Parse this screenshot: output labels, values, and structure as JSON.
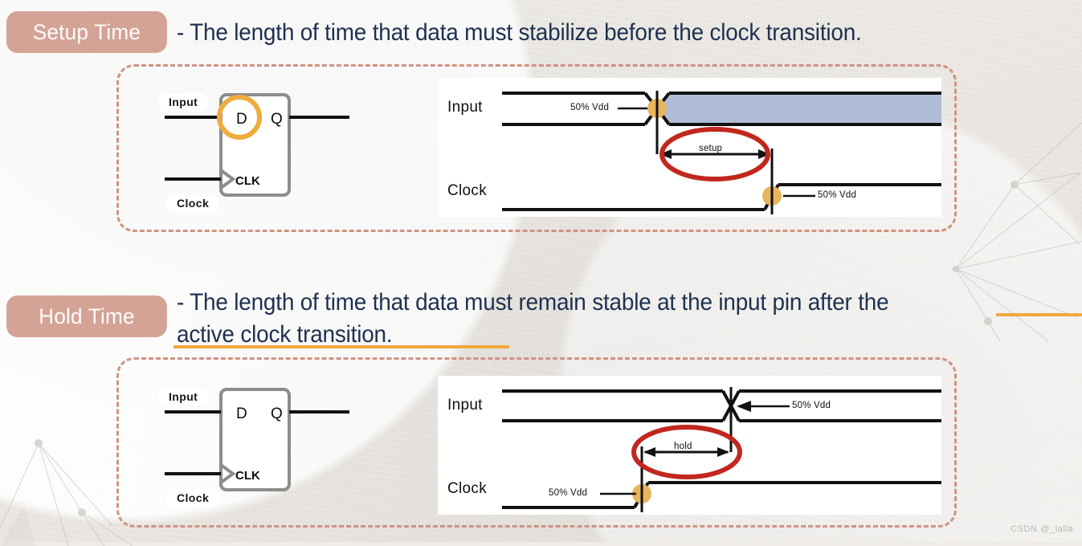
{
  "slide": {
    "background_color": "#efece7",
    "text_color": "#1d3050",
    "badge_color": "#d4a396",
    "dash_color": "#cf9383",
    "highlight_color": "#f0a83c",
    "band_color": "#b0bdd8",
    "ellipse_color": "#c0281e",
    "node_color": "#e8b45c"
  },
  "sections": [
    {
      "badge_label": "Setup Time",
      "description": "- The length of time that data must stabilize before the clock transition.",
      "flipflop": {
        "input_label": "Input",
        "clock_label": "Clock",
        "d_pin": "D",
        "q_pin": "Q",
        "clk_pin": "CLK",
        "highlighted_pin": "D"
      },
      "timing": {
        "input_row_label": "Input",
        "clock_row_label": "Clock",
        "input_threshold_label": "50% Vdd",
        "clock_threshold_label": "50% Vdd",
        "measure_label": "setup",
        "has_data_band": true
      }
    },
    {
      "badge_label": "Hold Time",
      "description_line1": "- The length of time that data must remain stable at the input pin after the",
      "description_line2": "active clock transition.",
      "flipflop": {
        "input_label": "Input",
        "clock_label": "Clock",
        "d_pin": "D",
        "q_pin": "Q",
        "clk_pin": "CLK",
        "highlighted_pin": ""
      },
      "timing": {
        "input_row_label": "Input",
        "clock_row_label": "Clock",
        "input_threshold_label": "50% Vdd",
        "clock_threshold_label": "50% Vdd",
        "measure_label": "hold",
        "has_data_band": false
      }
    }
  ],
  "watermark": "CSDN @_lalla"
}
